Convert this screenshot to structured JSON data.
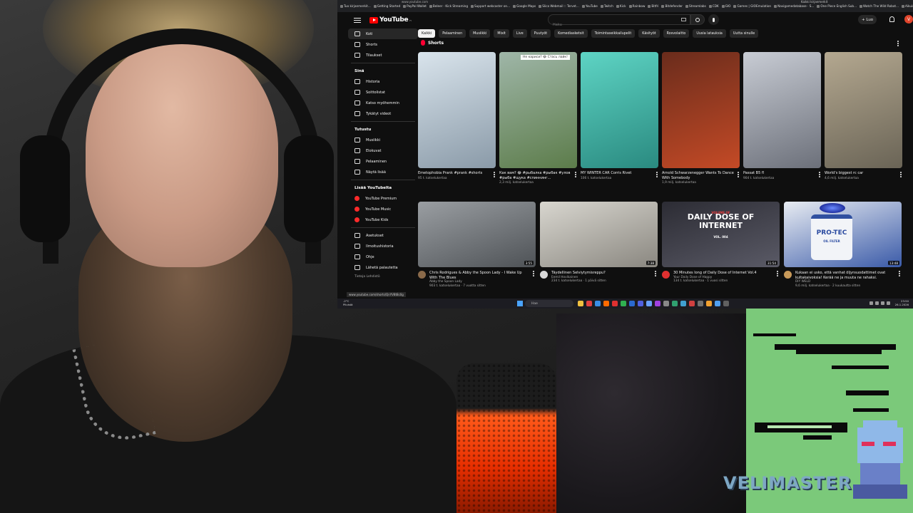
{
  "browser": {
    "url": "www.youtube.com",
    "bookmarks": [
      "Tuo kirjanmerkit...",
      "Getting Started",
      "PayPal Wallet",
      "Beleer · Kick Streaming",
      "Support webcaster on...",
      "Google Maps",
      "Slica Webmail :: Tervet...",
      "YouTube",
      "Twitch",
      "Kick",
      "Rainbow",
      "Bitfri",
      "Bitdefender",
      "Streamlabs",
      "CDK",
      "GIO",
      "Games | GIOEmulation",
      "Navigamedatabase · S...",
      "One Piece English Sub...",
      "Watch The Wild Robot...",
      "Aikuisten sosialipalvelut..."
    ],
    "top_right_bookmarks": [
      "Kaikki kirjanmerkit"
    ]
  },
  "youtube": {
    "logo_text": "YouTube",
    "country_code": "FI",
    "search_placeholder": "Haku",
    "create_label": "+ Luo",
    "avatar_letter": "V",
    "sidebar": {
      "primary": [
        {
          "label": "Koti",
          "icon": "home-icon",
          "active": true
        },
        {
          "label": "Shorts",
          "icon": "shorts-icon"
        },
        {
          "label": "Tilaukset",
          "icon": "subscriptions-icon"
        }
      ],
      "you_heading": "Sinä",
      "you": [
        {
          "label": "Historia",
          "icon": "history-icon"
        },
        {
          "label": "Soittolistat",
          "icon": "playlists-icon"
        },
        {
          "label": "Katso myöhemmin",
          "icon": "watch-later-icon"
        },
        {
          "label": "Tykätyt videot",
          "icon": "liked-icon"
        }
      ],
      "explore_heading": "Tutustu",
      "explore": [
        {
          "label": "Musiikki",
          "icon": "music-icon"
        },
        {
          "label": "Elokuvat",
          "icon": "movies-icon"
        },
        {
          "label": "Pelaaminen",
          "icon": "gaming-icon"
        },
        {
          "label": "Näytä lisää",
          "icon": "chevron-down-icon"
        }
      ],
      "more_heading": "Lisää YouTubelta",
      "more": [
        {
          "label": "YouTube Premium",
          "icon": "youtube-premium-icon"
        },
        {
          "label": "YouTube Music",
          "icon": "youtube-music-icon"
        },
        {
          "label": "YouTube Kids",
          "icon": "youtube-kids-icon"
        }
      ],
      "settings": [
        {
          "label": "Asetukset",
          "icon": "settings-icon"
        },
        {
          "label": "Ilmoitushistoria",
          "icon": "flag-icon"
        },
        {
          "label": "Ohje",
          "icon": "help-icon"
        },
        {
          "label": "Lähetä palautetta",
          "icon": "feedback-icon"
        }
      ],
      "footer": "Tietoja  Lehdistö"
    },
    "chips": [
      "Kaikki",
      "Pelaaminen",
      "Musiikki",
      "Mixit",
      "Live",
      "Puutyöt",
      "Komediasketsit",
      "Toimintaseikkailupelit",
      "Käsityöt",
      "Rosvolaitto",
      "Uusia latauksia",
      "Uutta sinulle"
    ],
    "shorts_heading": "Shorts",
    "shorts": [
      {
        "title": "Emetophobia Prank #prank #shorts",
        "views": "95 t. katselukertaa",
        "colors": [
          "#d9e4ec",
          "#8a9aa8"
        ]
      },
      {
        "title": "Как вам? 😂 #рыбалка #рыбак #улов #рыба #щука #спиннинг...",
        "views": "2,3 milj. katselukertaa",
        "caption": "Не кариси? 😂 Стась лайк!",
        "colors": [
          "#9fb6a8",
          "#5c7c4a"
        ]
      },
      {
        "title": "MY WINTER CAR  Corris Rivet",
        "views": "106 t. katselukertaa",
        "colors": [
          "#5ed4c4",
          "#2a8a80"
        ]
      },
      {
        "title": "Arnold Schwarzenegger Wants To Dance With Somebody",
        "views": "1,9 milj. katselukertaa",
        "colors": [
          "#6a2c1c",
          "#c44a26"
        ]
      },
      {
        "title": "Passat B5 fl",
        "views": "904 t. katselukertaa",
        "colors": [
          "#c8ccd4",
          "#6c707a"
        ]
      },
      {
        "title": "World's biggest rc car",
        "views": "4,6 milj. katselukertaa",
        "colors": [
          "#b4a890",
          "#6a6456"
        ]
      }
    ],
    "videos": [
      {
        "title": "Chris Rodrigues & Abby the Spoon Lady - I Wake Up With The Blues",
        "channel": "Abby the Spoon Lady",
        "stats": "903 t. katselukertaa · 7 vuotta sitten",
        "duration": "3:55",
        "colors": [
          "#9a9ea2",
          "#4e5256"
        ]
      },
      {
        "title": "Täydellinen Selviytymisreppu?",
        "channel": "Eemil Hovikainen",
        "stats": "234 t. katselukertaa · 1 päivä sitten",
        "duration": "7:38",
        "colors": [
          "#d8d6cf",
          "#8a8780"
        ]
      },
      {
        "title": "30 Minutes long of Daily Dose of Internet Vol.4",
        "channel": "Your Daily Dose of Happy",
        "stats": "134 t. katselukertaa · 1 vuosi sitten",
        "duration": "31:54",
        "overlay_top": "VOLUME OF",
        "overlay_main": "DAILY DOSE OF INTERNET",
        "overlay_sub": "VOL. 004",
        "colors": [
          "#2c2c34",
          "#5a5a66"
        ]
      },
      {
        "title": "Kukaan ei usko, että vanhat öljynsuodattimet ovat kultakaivoksia! Kerää ne ja muuta ne rahaksi.",
        "channel": "DIY WELD",
        "stats": "9,6 milj. katselukertaa · 2 kuukautta sitten",
        "duration": "13:48",
        "overlay_main": "PRO-TEC",
        "overlay_sub": "OIL FILTER",
        "colors": [
          "#e8ecf2",
          "#3a5aa8"
        ]
      }
    ],
    "status_tip": "www.youtube.com/shorts/QnYV8t8c0g"
  },
  "taskbar": {
    "weather_temp": "-2°C",
    "weather_desc": "Pilvistä",
    "search_label": "Hae",
    "time": "23:50",
    "date": "26.1.2026"
  },
  "overlay": {
    "brand": "VELIMASTER"
  }
}
